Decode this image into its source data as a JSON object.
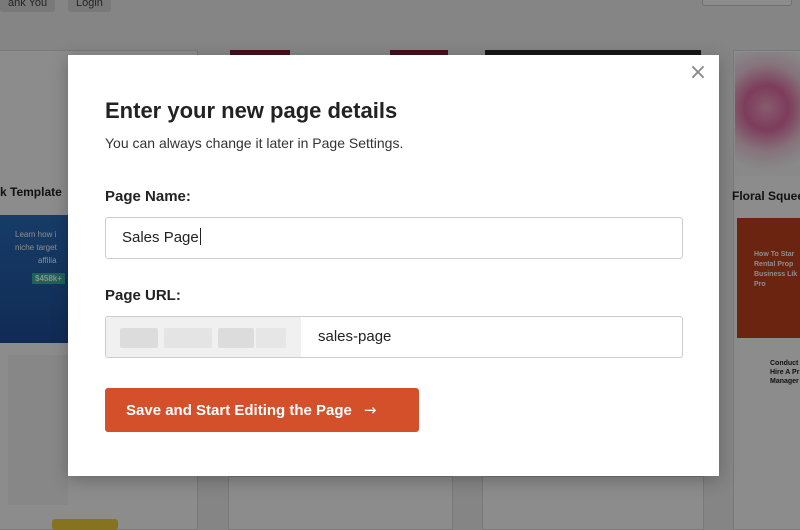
{
  "background": {
    "top_buttons": [
      "ank You",
      "Login"
    ],
    "card_labels": [
      "k Template",
      "Floral Squee"
    ],
    "teaser_lines": [
      "Learn how i",
      "niche target",
      "affilia",
      "$458k+"
    ],
    "right_thumb_lines": [
      "How To Star",
      "Rental Prop",
      "Business Lik",
      "Pro"
    ],
    "right_lower_lines": [
      "Conduct",
      "Hire A Pr",
      "Manager"
    ]
  },
  "modal": {
    "title": "Enter your new page details",
    "subtitle": "You can always change it later in Page Settings.",
    "name_label": "Page Name:",
    "name_value": "Sales Page",
    "url_label": "Page URL:",
    "url_value": "sales-page",
    "save_label": "Save and Start Editing the Page",
    "save_arrow": "→",
    "close_symbol": "×"
  },
  "colors": {
    "accent": "#d4502a",
    "overlay": "rgba(0,0,0,0.45)"
  }
}
